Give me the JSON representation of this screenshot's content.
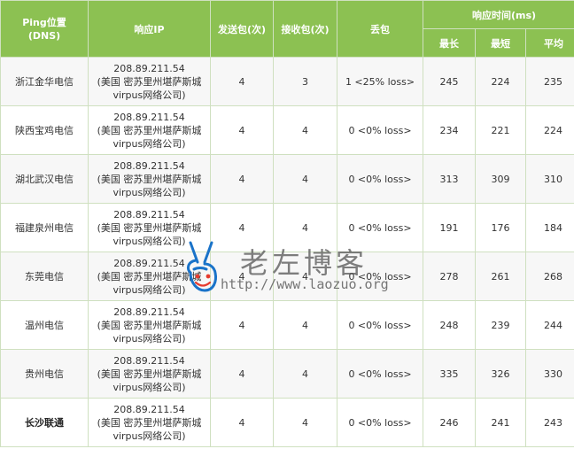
{
  "header": {
    "location": "Ping位置",
    "location_sub": "(DNS)",
    "ip": "响应IP",
    "sent": "发送包(次)",
    "recv": "接收包(次)",
    "loss": "丢包",
    "resp": "响应时间(ms)",
    "max": "最长",
    "min": "最短",
    "avg": "平均"
  },
  "rows": [
    {
      "location": "浙江金华电信",
      "ip": "208.89.211.54",
      "geo": "(美国 密苏里州堪萨斯城",
      "isp": "virpus网络公司)",
      "sent": "4",
      "recv": "3",
      "loss": "1 <25% loss>",
      "max": "245",
      "min": "224",
      "avg": "235"
    },
    {
      "location": "陕西宝鸡电信",
      "ip": "208.89.211.54",
      "geo": "(美国 密苏里州堪萨斯城",
      "isp": "virpus网络公司)",
      "sent": "4",
      "recv": "4",
      "loss": "0 <0% loss>",
      "max": "234",
      "min": "221",
      "avg": "224"
    },
    {
      "location": "湖北武汉电信",
      "ip": "208.89.211.54",
      "geo": "(美国 密苏里州堪萨斯城",
      "isp": "virpus网络公司)",
      "sent": "4",
      "recv": "4",
      "loss": "0 <0% loss>",
      "max": "313",
      "min": "309",
      "avg": "310"
    },
    {
      "location": "福建泉州电信",
      "ip": "208.89.211.54",
      "geo": "(美国 密苏里州堪萨斯城",
      "isp": "virpus网络公司)",
      "sent": "4",
      "recv": "4",
      "loss": "0 <0% loss>",
      "max": "191",
      "min": "176",
      "avg": "184"
    },
    {
      "location": "东莞电信",
      "ip": "208.89.211.54",
      "geo": "(美国 密苏里州堪萨斯城",
      "isp": "virpus网络公司)",
      "sent": "4",
      "recv": "4",
      "loss": "0 <0% loss>",
      "max": "278",
      "min": "261",
      "avg": "268"
    },
    {
      "location": "温州电信",
      "ip": "208.89.211.54",
      "geo": "(美国 密苏里州堪萨斯城",
      "isp": "virpus网络公司)",
      "sent": "4",
      "recv": "4",
      "loss": "0 <0% loss>",
      "max": "248",
      "min": "239",
      "avg": "244"
    },
    {
      "location": "贵州电信",
      "ip": "208.89.211.54",
      "geo": "(美国 密苏里州堪萨斯城",
      "isp": "virpus网络公司)",
      "sent": "4",
      "recv": "4",
      "loss": "0 <0% loss>",
      "max": "335",
      "min": "326",
      "avg": "330"
    },
    {
      "location": "长沙联通",
      "ip": "208.89.211.54",
      "geo": "(美国 密苏里州堪萨斯城",
      "isp": "virpus网络公司)",
      "sent": "4",
      "recv": "4",
      "loss": "0 <0% loss>",
      "max": "246",
      "min": "241",
      "avg": "243"
    }
  ],
  "watermark": {
    "title": "老左博客",
    "url": "http://www.laozuo.org",
    "icon": "victory-hand-icon"
  },
  "colors": {
    "header_bg": "#8cc152",
    "header_text": "#ffffff",
    "border": "#cfe0c0"
  }
}
